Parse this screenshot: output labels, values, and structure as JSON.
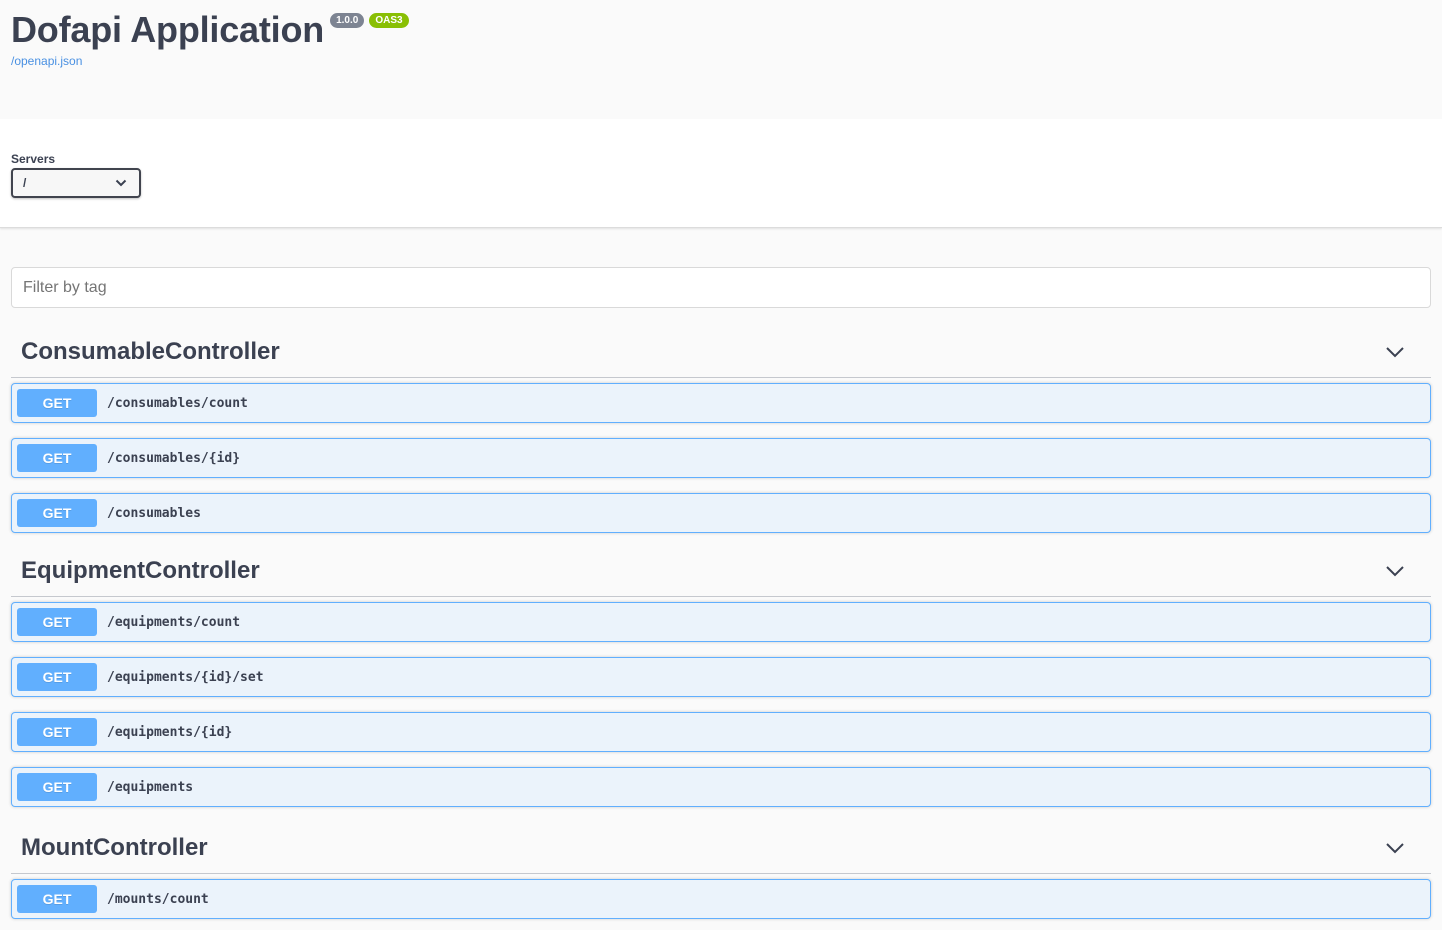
{
  "info": {
    "title": "Dofapi Application",
    "version": "1.0.0",
    "oas_badge": "OAS3",
    "spec_link": "/openapi.json"
  },
  "servers": {
    "label": "Servers",
    "selected": "/"
  },
  "filter": {
    "placeholder": "Filter by tag"
  },
  "colors": {
    "get": "#61affe",
    "get_bg": "#ebf3fb",
    "version_badge": "#7d8492",
    "oas_badge": "#89bf04",
    "link": "#4990e2"
  },
  "tags": [
    {
      "name": "ConsumableController",
      "operations": [
        {
          "method": "GET",
          "path": "/consumables/count"
        },
        {
          "method": "GET",
          "path": "/consumables/{id}"
        },
        {
          "method": "GET",
          "path": "/consumables"
        }
      ]
    },
    {
      "name": "EquipmentController",
      "operations": [
        {
          "method": "GET",
          "path": "/equipments/count"
        },
        {
          "method": "GET",
          "path": "/equipments/{id}/set"
        },
        {
          "method": "GET",
          "path": "/equipments/{id}"
        },
        {
          "method": "GET",
          "path": "/equipments"
        }
      ]
    },
    {
      "name": "MountController",
      "operations": [
        {
          "method": "GET",
          "path": "/mounts/count"
        }
      ]
    }
  ]
}
